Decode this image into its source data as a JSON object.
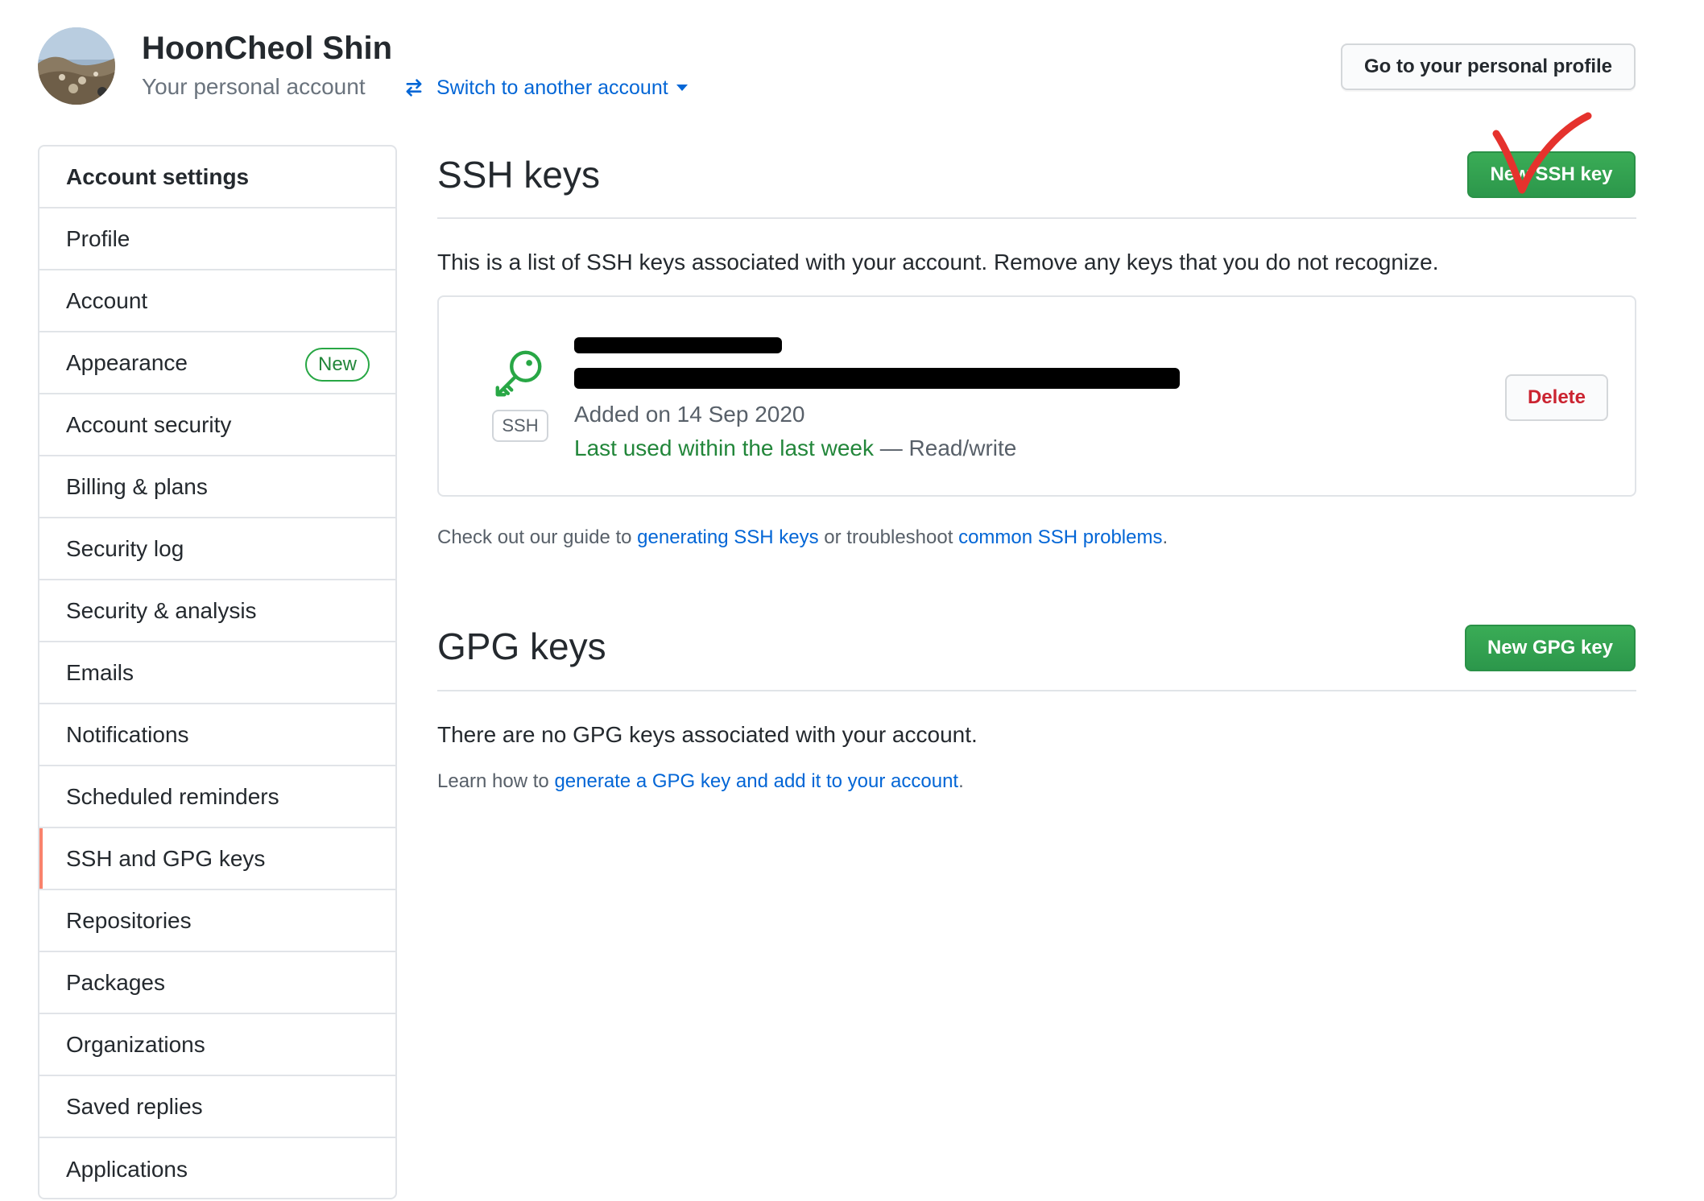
{
  "header": {
    "user_name": "HoonCheol Shin",
    "account_type": "Your personal account",
    "switch_label": "Switch to another account",
    "profile_button": "Go to your personal profile"
  },
  "sidebar": {
    "header": "Account settings",
    "items": [
      {
        "label": "Profile"
      },
      {
        "label": "Account"
      },
      {
        "label": "Appearance",
        "badge": "New"
      },
      {
        "label": "Account security"
      },
      {
        "label": "Billing & plans"
      },
      {
        "label": "Security log"
      },
      {
        "label": "Security & analysis"
      },
      {
        "label": "Emails"
      },
      {
        "label": "Notifications"
      },
      {
        "label": "Scheduled reminders"
      },
      {
        "label": "SSH and GPG keys",
        "selected": true
      },
      {
        "label": "Repositories"
      },
      {
        "label": "Packages"
      },
      {
        "label": "Organizations"
      },
      {
        "label": "Saved replies"
      },
      {
        "label": "Applications"
      }
    ]
  },
  "ssh": {
    "title": "SSH keys",
    "new_button": "New SSH key",
    "description": "This is a list of SSH keys associated with your account. Remove any keys that you do not recognize.",
    "key": {
      "type_label": "SSH",
      "added": "Added on 14 Sep 2020",
      "last_used": "Last used within the last week",
      "access": " — Read/write",
      "delete_button": "Delete"
    },
    "guide": {
      "prefix": "Check out our guide to ",
      "link1": "generating SSH keys",
      "middle": " or troubleshoot ",
      "link2": "common SSH problems",
      "suffix": "."
    }
  },
  "gpg": {
    "title": "GPG keys",
    "new_button": "New GPG key",
    "empty_text": "There are no GPG keys associated with your account.",
    "learn": {
      "prefix": "Learn how to ",
      "link": "generate a GPG key and add it to your account",
      "suffix": "."
    }
  },
  "colors": {
    "link": "#0366d6",
    "green_button": "#2ea44f",
    "success_text": "#22863a",
    "danger": "#cb2431",
    "selected_marker": "#f9826c",
    "annotation": "#e5322d"
  }
}
